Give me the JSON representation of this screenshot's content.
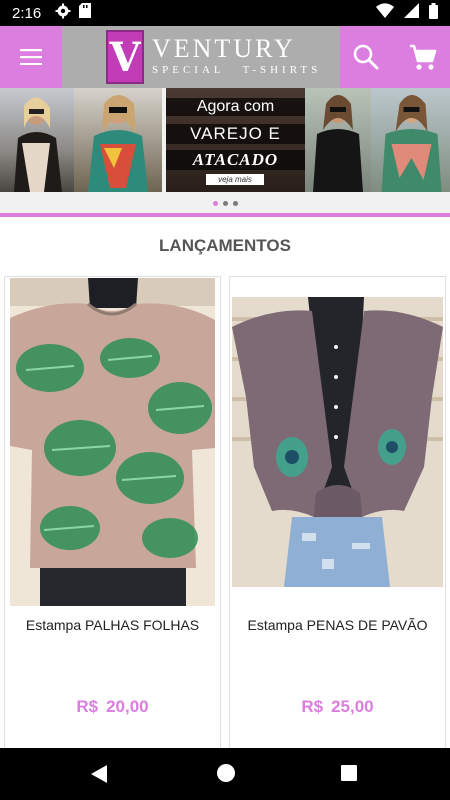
{
  "status_bar": {
    "time": "2:16",
    "icons": [
      "gear-icon",
      "sd-card-icon",
      "wifi-icon",
      "signal-icon",
      "battery-icon"
    ]
  },
  "app_bar": {
    "brand_title": "VENTURY",
    "brand_subtitle_left": "SPECIAL",
    "brand_subtitle_right": "T-SHIRTS",
    "menu_icon": "hamburger-menu-icon",
    "search_icon": "search-icon",
    "cart_icon": "shopping-cart-icon",
    "colors": {
      "accent": "#dc7de0",
      "logo_bg": "#adadad"
    }
  },
  "banner": {
    "line1": "Agora com",
    "line2": "VAREJO E",
    "line3": "ATACADO",
    "cta": "veja mais",
    "slide_count": 3,
    "active_slide": 1
  },
  "section": {
    "title": "LANÇAMENTOS"
  },
  "products": [
    {
      "name": "Estampa PALHAS FOLHAS",
      "currency": "R$",
      "price": "20,00"
    },
    {
      "name": "Estampa PENAS DE PAVÃO",
      "currency": "R$",
      "price": "25,00"
    }
  ],
  "nav_bar": {
    "icons": [
      "back-icon",
      "home-icon",
      "recents-icon"
    ]
  }
}
